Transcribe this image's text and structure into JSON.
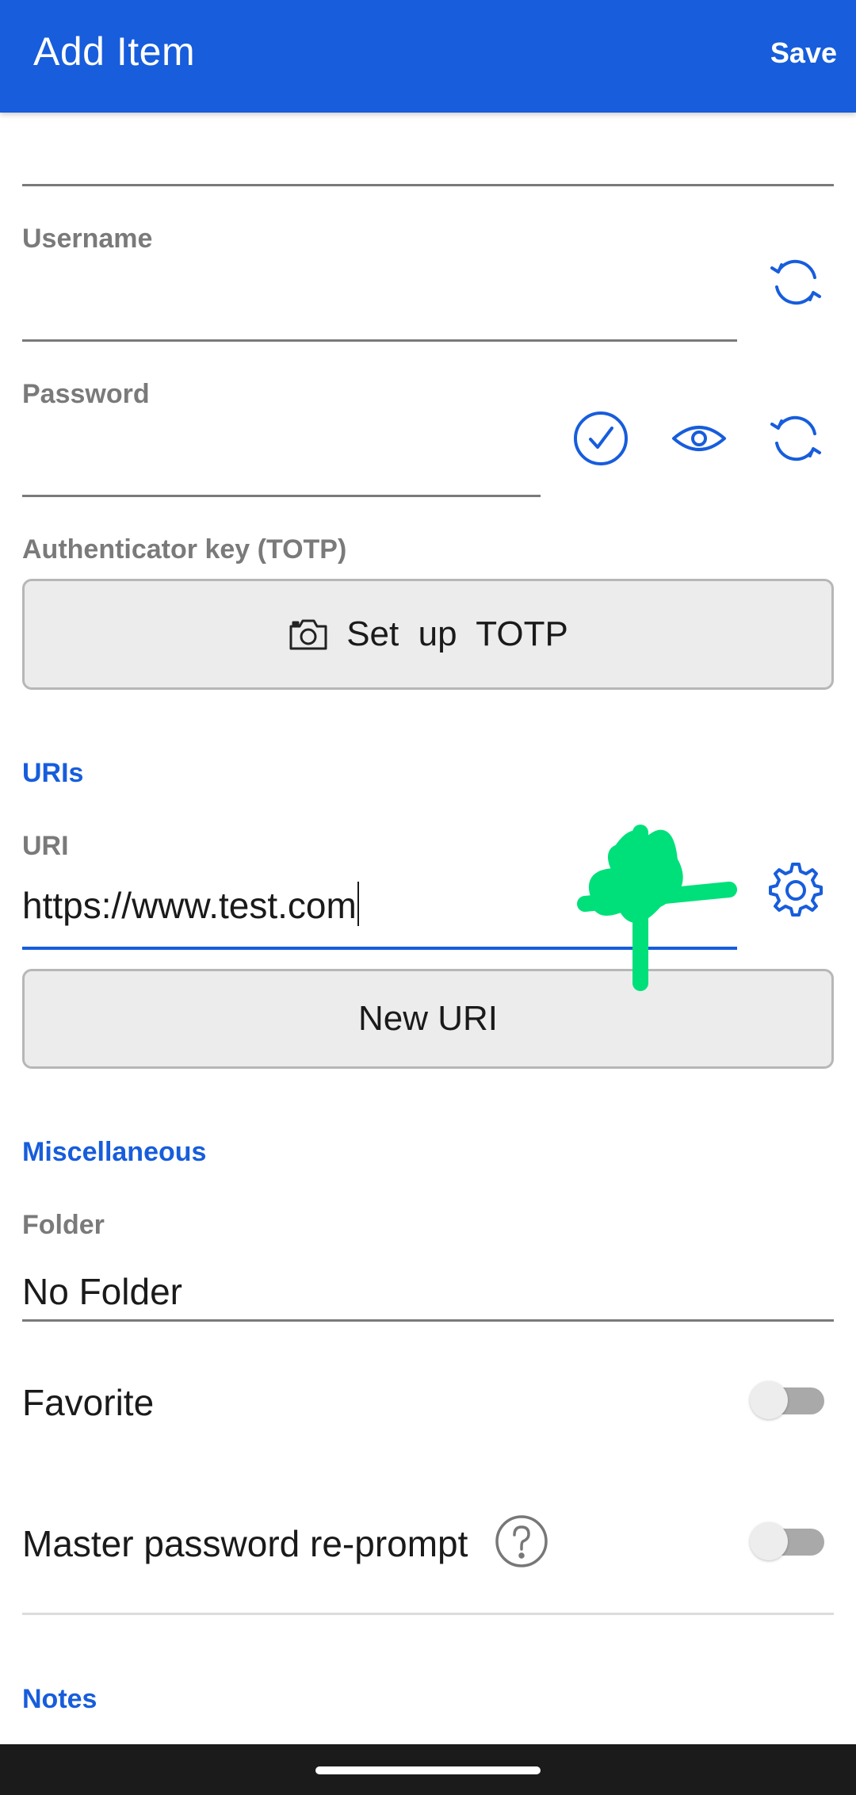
{
  "appbar": {
    "title": "Add Item",
    "save_label": "Save"
  },
  "fields": {
    "username_label": "Username",
    "password_label": "Password",
    "totp_label": "Authenticator key (TOTP)",
    "setup_totp_label": "Set  up  TOTP"
  },
  "uris": {
    "section_title": "URIs",
    "uri_label": "URI",
    "uri_value": "https://www.test.com",
    "new_uri_label": "New URI"
  },
  "misc": {
    "section_title": "Miscellaneous",
    "folder_label": "Folder",
    "folder_value": "No Folder",
    "favorite_label": "Favorite",
    "favorite_on": false,
    "reprompt_label": "Master password re-prompt",
    "reprompt_on": false
  },
  "notes": {
    "section_title": "Notes"
  },
  "colors": {
    "accent": "#175ddc",
    "label_gray": "#7a7a7a",
    "annotation_green": "#00e07a"
  },
  "icons": {
    "username_action": "refresh-icon",
    "password_check": "check-circle-icon",
    "password_toggle": "eye-icon",
    "password_generate": "refresh-icon",
    "totp": "camera-icon",
    "uri_options": "gear-icon",
    "reprompt_help": "question-circle-icon"
  }
}
